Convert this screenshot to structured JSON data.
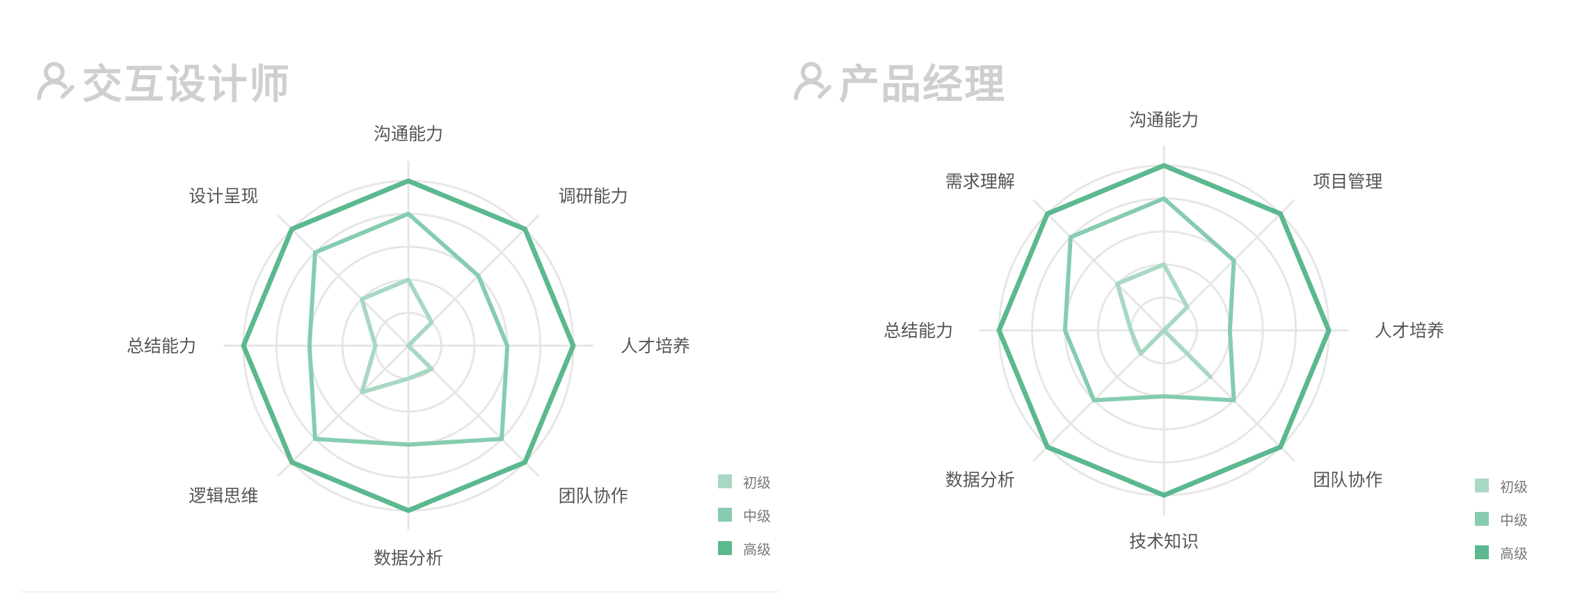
{
  "colors": {
    "title": "#cfcfcf",
    "grid": "#e6e6e6",
    "axis_label": "#555555",
    "legend_label": "#777777"
  },
  "chart_data": [
    {
      "type": "radar",
      "title": "交互设计师",
      "title_icon": "user-icon",
      "axes": [
        "沟通能力",
        "调研能力",
        "人才培养",
        "团队协作",
        "数据分析",
        "逻辑思维",
        "总结能力",
        "设计呈现"
      ],
      "rings": 5,
      "max": 5,
      "grid": true,
      "legend_position": "bottom-right",
      "series": [
        {
          "name": "初级",
          "color": "#a8d8c3",
          "values": [
            2,
            1,
            0,
            1,
            1,
            2,
            1,
            2
          ]
        },
        {
          "name": "中级",
          "color": "#86ccaf",
          "values": [
            4,
            3,
            3,
            4,
            3,
            4,
            3,
            4
          ]
        },
        {
          "name": "高级",
          "color": "#5cb88f",
          "values": [
            5,
            5,
            5,
            5,
            5,
            5,
            5,
            5
          ]
        }
      ]
    },
    {
      "type": "radar",
      "title": "产品经理",
      "title_icon": "user-icon",
      "axes": [
        "沟通能力",
        "项目管理",
        "人才培养",
        "团队协作",
        "技术知识",
        "数据分析",
        "总结能力",
        "需求理解"
      ],
      "rings": 5,
      "max": 5,
      "grid": true,
      "legend_position": "bottom-right",
      "series": [
        {
          "name": "初级",
          "color": "#a8d8c3",
          "values": [
            2,
            1,
            0,
            2,
            0,
            1,
            1,
            2
          ]
        },
        {
          "name": "中级",
          "color": "#86ccaf",
          "values": [
            4,
            3,
            2,
            3,
            2,
            3,
            3,
            4
          ]
        },
        {
          "name": "高级",
          "color": "#5cb88f",
          "values": [
            5,
            5,
            5,
            5,
            5,
            5,
            5,
            5
          ]
        }
      ]
    }
  ]
}
